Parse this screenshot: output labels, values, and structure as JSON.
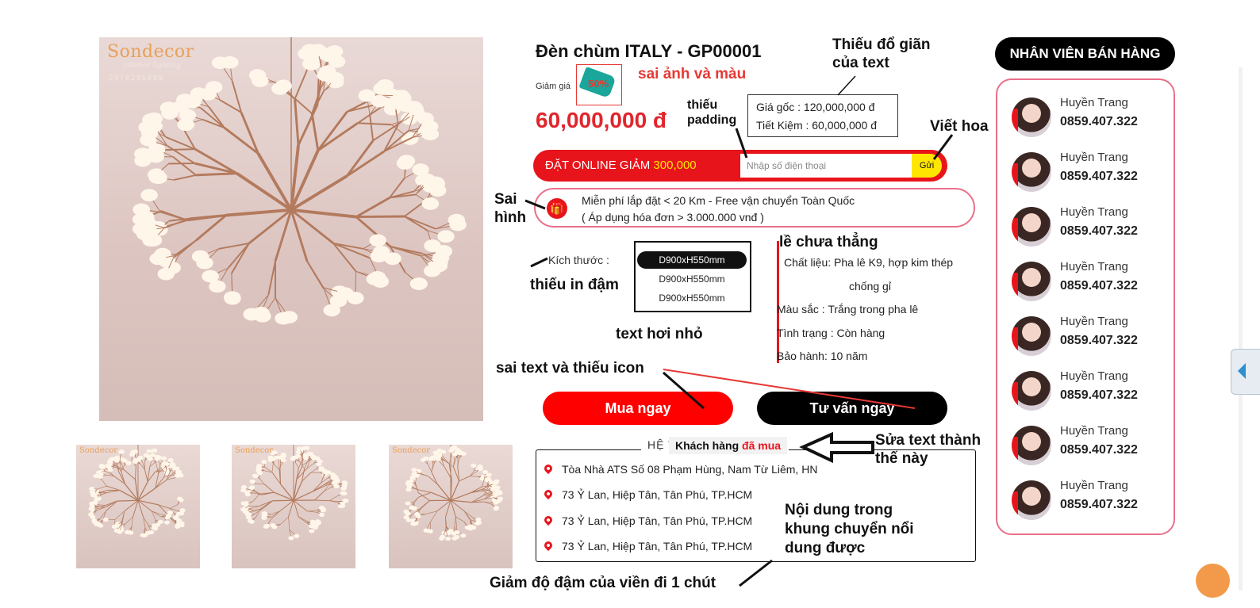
{
  "product": {
    "title": "Đèn chùm ITALY - GP00001",
    "discount_label": "Giảm giá",
    "discount_tag": "50%",
    "price": "60,000,000 đ",
    "original_price": "Giá gốc : 120,000,000 đ",
    "savings": "Tiết Kiệm : 60,000,000 đ"
  },
  "brand": {
    "logo": "Sondecor",
    "tagline": "interior lighting",
    "phone": "0978285888"
  },
  "order_bar": {
    "label_prefix": "ĐẶT ONLINE GIẢM",
    "label_amount": "300,000",
    "phone_placeholder": "Nhập số điện thoại",
    "send_label": "Gửi"
  },
  "promo": {
    "line1": "Miễn phí lắp đặt < 20 Km - Free vận chuyển Toàn Quốc",
    "line2": "( Áp dụng hóa đơn > 3.000.000 vnđ )"
  },
  "size": {
    "label": "Kích thước :",
    "options": [
      "D900xH550mm",
      "D900xH550mm",
      "D900xH550mm"
    ]
  },
  "specs": {
    "material_1": "Chất liệu: Pha lê K9, hợp kim thép",
    "material_2": "chống gỉ",
    "color": "Màu sắc : Trắng trong pha lê",
    "status": "Tình trạng : Còn hàng",
    "warranty": "Bảo hành: 10 năm"
  },
  "buttons": {
    "buy": "Mua ngay",
    "advise": "Tư vấn ngay"
  },
  "stores": {
    "title": "HỆ THỐNG CỬA HÀNG",
    "new_label_prefix": "Khách hàng",
    "new_label_suffix": "đã mua",
    "items": [
      "Tòa Nhà ATS Số 08 Phạm Hùng, Nam Từ Liêm, HN",
      "73 Ỷ Lan, Hiệp Tân, Tân Phú, TP.HCM",
      "73 Ỷ Lan, Hiệp Tân, Tân Phú, TP.HCM",
      "73 Ỷ Lan, Hiệp Tân, Tân Phú, TP.HCM"
    ]
  },
  "staff": {
    "title": "NHÂN VIÊN BÁN HÀNG",
    "members": [
      {
        "name": "Huyền Trang",
        "phone": "0859.407.322"
      },
      {
        "name": "Huyền Trang",
        "phone": "0859.407.322"
      },
      {
        "name": "Huyền Trang",
        "phone": "0859.407.322"
      },
      {
        "name": "Huyền Trang",
        "phone": "0859.407.322"
      },
      {
        "name": "Huyền Trang",
        "phone": "0859.407.322"
      },
      {
        "name": "Huyền Trang",
        "phone": "0859.407.322"
      },
      {
        "name": "Huyền Trang",
        "phone": "0859.407.322"
      },
      {
        "name": "Huyền Trang",
        "phone": "0859.407.322"
      }
    ]
  },
  "annotations": {
    "wrong_image_color": "sai ảnh và màu",
    "missing_spacing_1": "Thiếu đổ giãn",
    "missing_spacing_2": "của text",
    "missing_padding_1": "thiếu",
    "missing_padding_2": "padding",
    "capitalize": "Viết hoa",
    "wrong_icon_1": "Sai",
    "wrong_icon_2": "hình",
    "margin_not_aligned": "lề chưa thẳng",
    "missing_bold": "thiếu in đậm",
    "text_small": "text hơi nhỏ",
    "wrong_text_icon": "sai text và thiếu icon",
    "change_text_1": "Sửa text thành",
    "change_text_2": "thế này",
    "scroll_content_1": "Nội dung trong",
    "scroll_content_2": "khung chuyển nổi",
    "scroll_content_3": "dung được",
    "reduce_border": "Giảm độ đậm của viền đi 1 chút"
  }
}
